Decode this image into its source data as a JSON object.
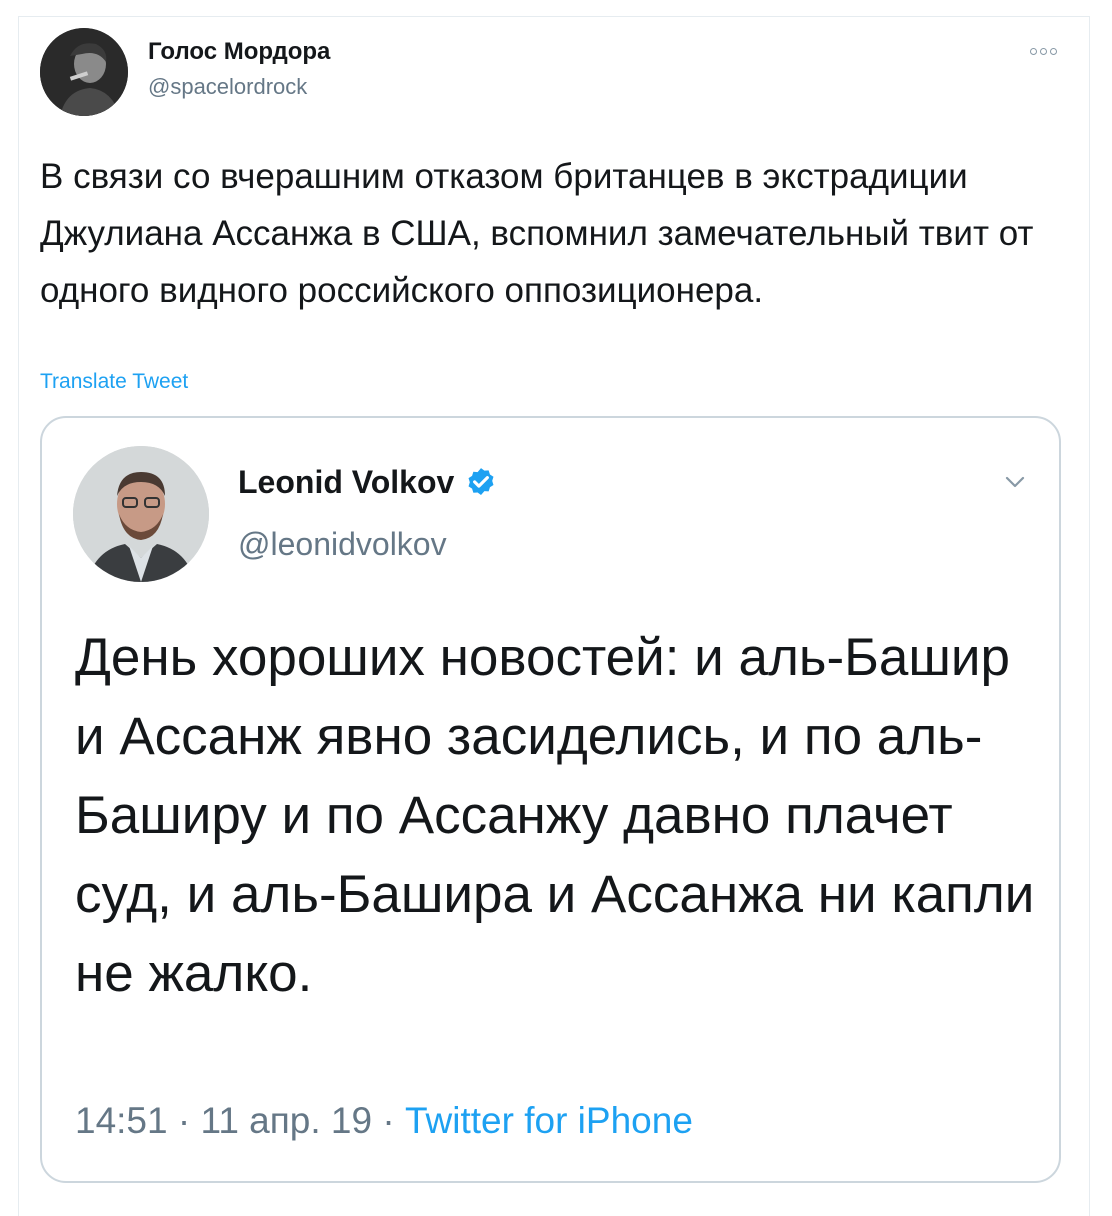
{
  "tweet": {
    "author_name": "Голос Мордора",
    "author_handle": "@spacelordrock",
    "text": "В связи со вчерашним отказом британцев в экстрадиции Джулиана Ассанжа в США, вспомнил замечательный твит от одного видного российского оппозиционера.",
    "translate_label": "Translate Tweet",
    "more_icon": "more-icon"
  },
  "quoted_tweet": {
    "author_name": "Leonid Volkov",
    "author_handle": "@leonidvolkov",
    "verified": true,
    "text": "День хороших новостей: и аль-Башир и Ассанж явно засиделись, и по аль-Баширу и по Ассанжу давно плачет суд, и аль-Башира и Ассанжа ни капли не жалко.",
    "time": "14:51",
    "date": "11 апр. 19",
    "separator": "·",
    "source": "Twitter for iPhone"
  },
  "colors": {
    "link_blue": "#1da1f2",
    "secondary_text": "#657786",
    "border": "#ccd6dd"
  }
}
